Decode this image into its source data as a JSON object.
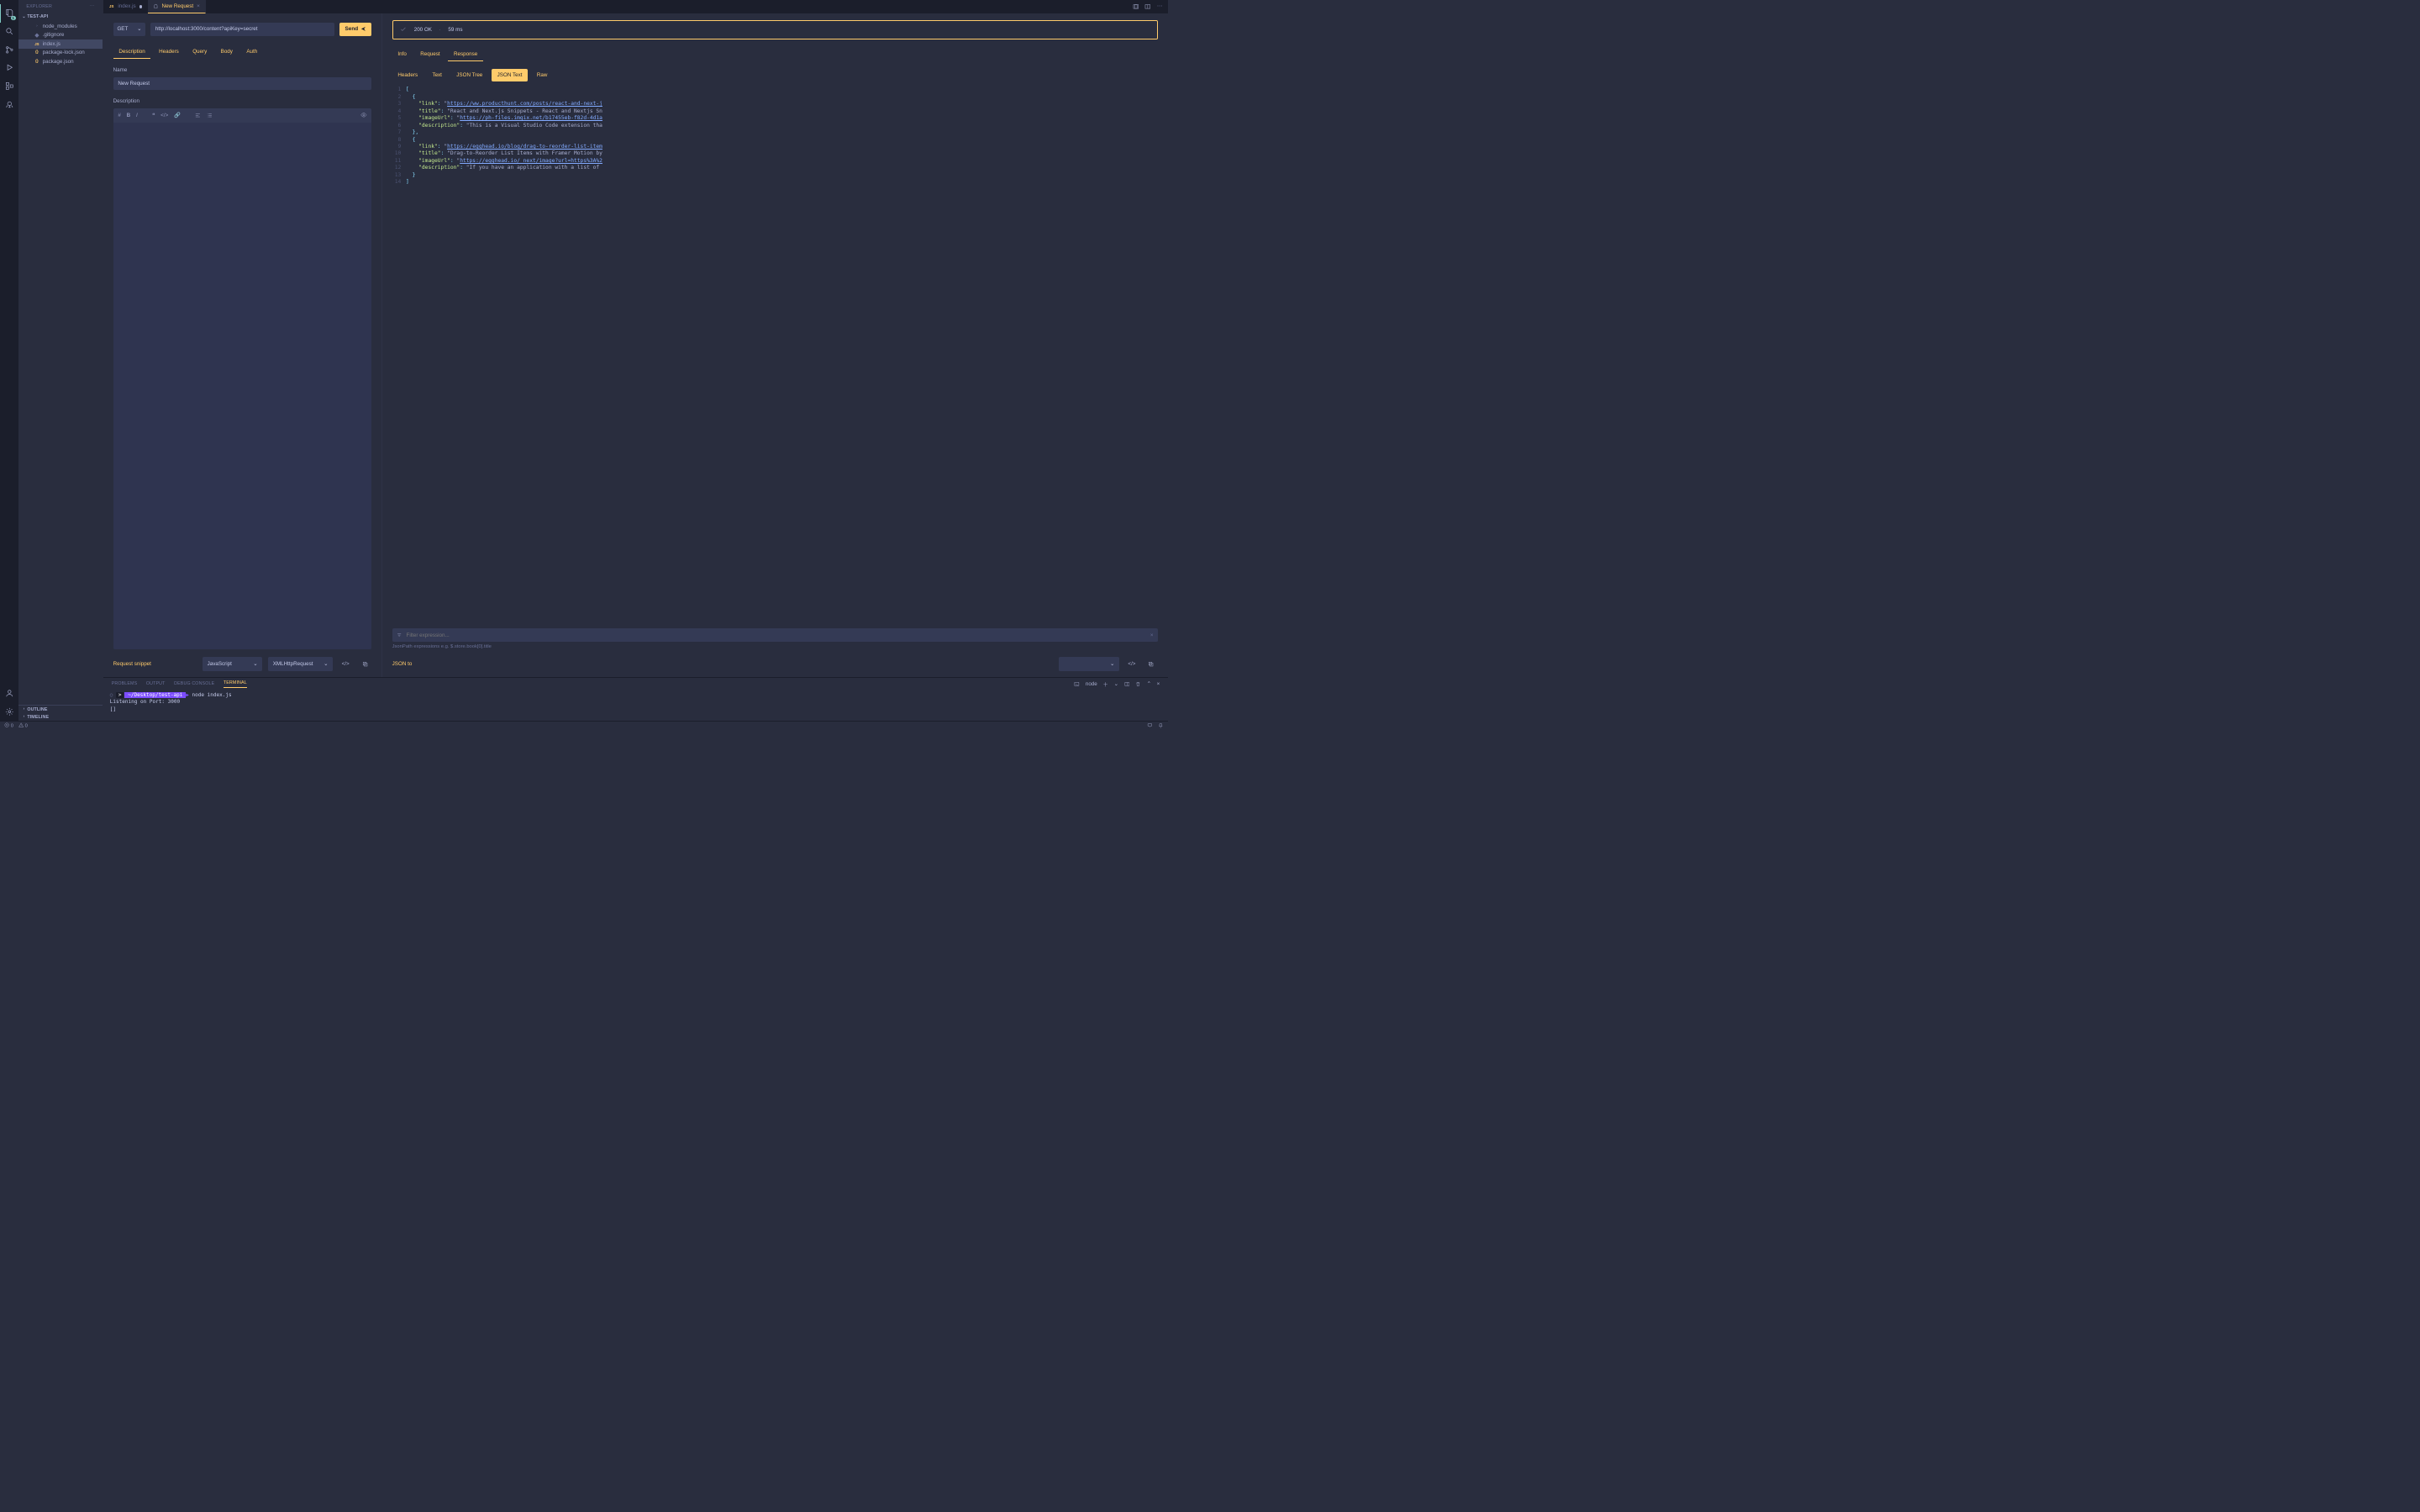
{
  "explorer": {
    "title": "EXPLORER",
    "root": "TEST-API",
    "tree": [
      {
        "label": "node_modules",
        "icon": "chevron"
      },
      {
        "label": ".gitignore",
        "icon": "gitignore"
      },
      {
        "label": "index.js",
        "icon": "js",
        "selected": true
      },
      {
        "label": "package-lock.json",
        "icon": "json"
      },
      {
        "label": "package.json",
        "icon": "json"
      }
    ],
    "outline": "OUTLINE",
    "timeline": "TIMELINE"
  },
  "tabs": [
    {
      "label": "index.js",
      "icon": "js",
      "dirty": true
    },
    {
      "label": "New Request",
      "icon": "ghost",
      "active": true,
      "closable": true
    }
  ],
  "request": {
    "method": "GET",
    "url": "http://localhost:3000/content?apiKey=secret",
    "send": "Send",
    "tabs": [
      "Description",
      "Headers",
      "Query",
      "Body",
      "Auth"
    ],
    "activeTab": "Description",
    "nameLabel": "Name",
    "nameValue": "New Request",
    "descLabel": "Description",
    "snippetLabel": "Request snippet",
    "snippetLang": "JavaScript",
    "snippetLib": "XMLHttpRequest"
  },
  "response": {
    "status": "200 OK",
    "time": "59 ms",
    "tabs": [
      "Info",
      "Request",
      "Response"
    ],
    "activeTab": "Response",
    "formats": [
      "Headers",
      "Text",
      "JSON Tree",
      "JSON Text",
      "Raw"
    ],
    "activeFormat": "JSON Text",
    "filterPlaceholder": "Filter expression...",
    "filterHint": "JsonPath expressions e.g. $.store.book[0].title",
    "jsonToLabel": "JSON to",
    "lines": [
      "[",
      "  {",
      "    \"link\": \"https://ww.producthunt.com/posts/react-and-next-j",
      "    \"title\": \"React and Next.js Snippets - React and Nextjs Sn",
      "    \"imageUrl\": \"https://ph-files.imgix.net/b17455eb-f82d-4d1a",
      "    \"description\": \"This is a Visual Studio Code extension tha",
      "  },",
      "  {",
      "    \"link\": \"https://egghead.io/blog/drag-to-reorder-list-item",
      "    \"title\": \"Drag-to-Reorder List Items with Framer Motion by",
      "    \"imageUrl\": \"https://egghead.io/_next/image?url=https%3A%2",
      "    \"description\": \"If you have an application with a list of ",
      "  }",
      "]"
    ]
  },
  "terminal": {
    "tabs": [
      "PROBLEMS",
      "OUTPUT",
      "DEBUG CONSOLE",
      "TERMINAL"
    ],
    "activeTab": "TERMINAL",
    "kernel": "node",
    "promptPath": "~/Desktop/test-api",
    "cmd": "node index.js",
    "out1": "Listening on Port: 3000",
    "out2": "[]"
  },
  "status": {
    "errs": "0",
    "warns": "0"
  },
  "activityBadge": "1"
}
